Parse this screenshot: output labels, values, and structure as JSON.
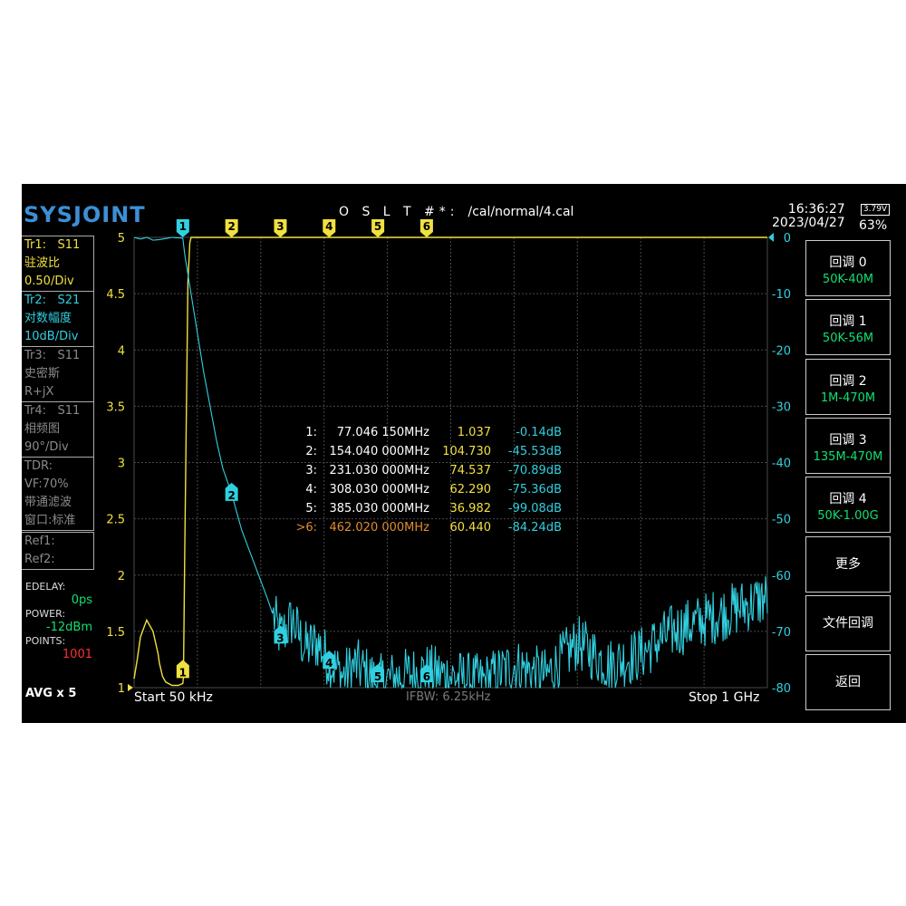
{
  "header": {
    "logo": "SYSJOINT",
    "cal_keys": "O S L T #*:",
    "cal_path": "/cal/normal/4.cal",
    "time": "16:36:27",
    "date": "2023/04/27",
    "battery_voltage": "3.79V",
    "battery_percent": "63%"
  },
  "traces": [
    {
      "name": "Tr1:",
      "param": "S11",
      "format": "驻波比",
      "scale": "0.50/Div",
      "color": "yellow"
    },
    {
      "name": "Tr2:",
      "param": "S21",
      "format": "对数幅度",
      "scale": "10dB/Div",
      "color": "cyan"
    },
    {
      "name": "Tr3:",
      "param": "S11",
      "format": "史密斯",
      "scale": "R+jX",
      "color": "gray"
    },
    {
      "name": "Tr4:",
      "param": "S11",
      "format": "相频图",
      "scale": "90°/Div",
      "color": "gray"
    }
  ],
  "tdr": {
    "label": "TDR:",
    "vf": "VF:70%",
    "mode": "带通滤波",
    "window": "窗口:标准"
  },
  "refs": [
    "Ref1:",
    "Ref2:"
  ],
  "status": {
    "edelay_label": "EDELAY:",
    "edelay_value": "0ps",
    "power_label": "POWER:",
    "power_value": "-12dBm",
    "points_label": "POINTS:",
    "points_value": "1001",
    "avg": "AVG x 5"
  },
  "footer": {
    "start": "Start  50 kHz",
    "ifbw": "IFBW: 6.25kHz",
    "stop": "Stop  1 GHz"
  },
  "markers": [
    {
      "id": "1:",
      "freq": "77.046 150MHz",
      "val1": "1.037",
      "val2": "-0.14dB",
      "active": false
    },
    {
      "id": "2:",
      "freq": "154.040 000MHz",
      "val1": "104.730",
      "val2": "-45.53dB",
      "active": false
    },
    {
      "id": "3:",
      "freq": "231.030 000MHz",
      "val1": "74.537",
      "val2": "-70.89dB",
      "active": false
    },
    {
      "id": "4:",
      "freq": "308.030 000MHz",
      "val1": "62.290",
      "val2": "-75.36dB",
      "active": false
    },
    {
      "id": "5:",
      "freq": "385.030 000MHz",
      "val1": "36.982",
      "val2": "-99.08dB",
      "active": false
    },
    {
      "id": ">6:",
      "freq": "462.020 000MHz",
      "val1": "60.440",
      "val2": "-84.24dB",
      "active": true
    }
  ],
  "softkeys": [
    {
      "title": "回调 0",
      "sub": "50K-40M"
    },
    {
      "title": "回调 1",
      "sub": "50K-56M"
    },
    {
      "title": "回调 2",
      "sub": "1M-470M"
    },
    {
      "title": "回调 3",
      "sub": "135M-470M"
    },
    {
      "title": "回调 4",
      "sub": "50K-1.00G"
    },
    {
      "title": "更多",
      "sub": ""
    },
    {
      "title": "文件回调",
      "sub": ""
    },
    {
      "title": "返回",
      "sub": ""
    }
  ],
  "colors": {
    "yellow": "#f0e040",
    "cyan": "#30d0e0",
    "gray": "#8a8a8a",
    "green": "#10e070",
    "orange": "#e08a30"
  },
  "chart_data": {
    "type": "line",
    "x_unit": "MHz",
    "x_range": [
      0.05,
      1000
    ],
    "left_axis": {
      "ticks": [
        "5",
        "4.5",
        "4",
        "3.5",
        "3",
        "2.5",
        "2",
        "1.5",
        "1"
      ],
      "range": [
        1,
        5
      ]
    },
    "right_axis": {
      "ticks": [
        "0",
        "-10",
        "-20",
        "-30",
        "-40",
        "-50",
        "-60",
        "-70",
        "-80"
      ],
      "range": [
        -80,
        0
      ]
    },
    "marker_labels": [
      "1",
      "2",
      "3",
      "4",
      "5",
      "6"
    ],
    "series": [
      {
        "param": "S11",
        "axis": "left",
        "x": [
          0.05,
          5,
          10,
          20,
          30,
          38,
          40,
          45,
          50,
          60,
          70,
          77.05,
          78,
          80,
          85,
          88,
          90,
          100,
          150,
          200,
          300,
          400,
          500,
          600,
          700,
          800,
          900,
          1000
        ],
        "y": [
          1.08,
          1.25,
          1.45,
          1.6,
          1.5,
          1.3,
          1.22,
          1.1,
          1.05,
          1.02,
          1.02,
          1.037,
          1.1,
          2.2,
          4.6,
          4.95,
          5,
          5,
          5,
          5,
          5,
          5,
          5,
          5,
          5,
          5,
          5,
          5
        ]
      },
      {
        "param": "S21",
        "axis": "right",
        "x": [
          0.05,
          10,
          20,
          30,
          40,
          50,
          60,
          70,
          75,
          77.05,
          80,
          90,
          100,
          110,
          120,
          130,
          140,
          154.04,
          170,
          190,
          210,
          231.03,
          250,
          270,
          290,
          308.03,
          330,
          350,
          385.03,
          420,
          462.02,
          500,
          550,
          600,
          650,
          700,
          750,
          800,
          850,
          900,
          950,
          1000
        ],
        "y": [
          0,
          -0.3,
          0,
          -0.5,
          -0.4,
          -0.2,
          0,
          -0.1,
          -0.1,
          -0.14,
          -3,
          -10,
          -17,
          -24,
          -30,
          -36,
          -41,
          -45.53,
          -52,
          -58,
          -64,
          -70.89,
          -68,
          -73,
          -72,
          -75.36,
          -78,
          -76,
          -79,
          -78,
          -77,
          -78,
          -79,
          -76,
          -78,
          -72,
          -76,
          -74,
          -70,
          -68,
          -66,
          -64
        ]
      }
    ]
  }
}
